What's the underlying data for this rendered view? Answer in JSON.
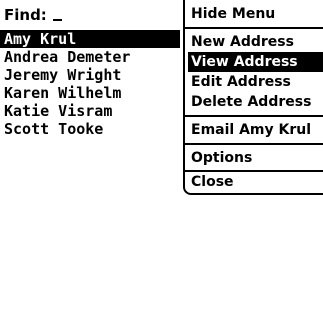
{
  "find": {
    "label": "Find:"
  },
  "contacts": [
    {
      "name": "Amy Krul",
      "selected": true
    },
    {
      "name": "Andrea Demeter",
      "selected": false
    },
    {
      "name": "Jeremy Wright",
      "selected": false
    },
    {
      "name": "Karen Wilhelm",
      "selected": false
    },
    {
      "name": "Katie Visram",
      "selected": false
    },
    {
      "name": "Scott Tooke",
      "selected": false
    }
  ],
  "menu": {
    "items": [
      {
        "label": "Hide Menu"
      },
      {
        "label": "New Address"
      },
      {
        "label": "View Address"
      },
      {
        "label": "Edit Address"
      },
      {
        "label": "Delete Address"
      },
      {
        "label": "Email Amy Krul"
      },
      {
        "label": "Options"
      },
      {
        "label": "Close"
      }
    ],
    "selected_label": "View Address"
  },
  "colors": {
    "background": "#ffffff",
    "text": "#000000",
    "highlight": "#000000",
    "highlight_text": "#ffffff"
  }
}
